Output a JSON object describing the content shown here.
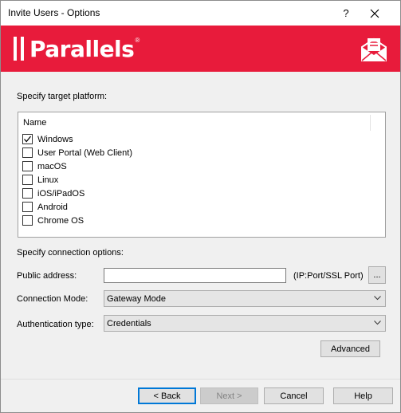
{
  "window": {
    "title": "Invite Users - Options",
    "help_glyph": "?",
    "close_icon": "close-icon"
  },
  "banner": {
    "brand_color": "#e81b3b",
    "logo_text": "Parallels",
    "logo_reg": "®",
    "icon": "mail-icon"
  },
  "platform": {
    "section_label": "Specify target platform:",
    "column_header": "Name",
    "items": [
      {
        "label": "Windows",
        "checked": true
      },
      {
        "label": "User Portal (Web Client)",
        "checked": false
      },
      {
        "label": "macOS",
        "checked": false
      },
      {
        "label": "Linux",
        "checked": false
      },
      {
        "label": "iOS/iPadOS",
        "checked": false
      },
      {
        "label": "Android",
        "checked": false
      },
      {
        "label": "Chrome OS",
        "checked": false
      }
    ]
  },
  "connection": {
    "section_label": "Specify connection options:",
    "public_address_label": "Public address:",
    "public_address_value": "",
    "public_address_hint": "(IP:Port/SSL Port)",
    "browse_label": "...",
    "mode_label": "Connection Mode:",
    "mode_value": "Gateway Mode",
    "auth_label": "Authentication type:",
    "auth_value": "Credentials",
    "advanced_label": "Advanced"
  },
  "footer": {
    "back_label": "< Back",
    "next_label": "Next >",
    "cancel_label": "Cancel",
    "help_label": "Help"
  }
}
